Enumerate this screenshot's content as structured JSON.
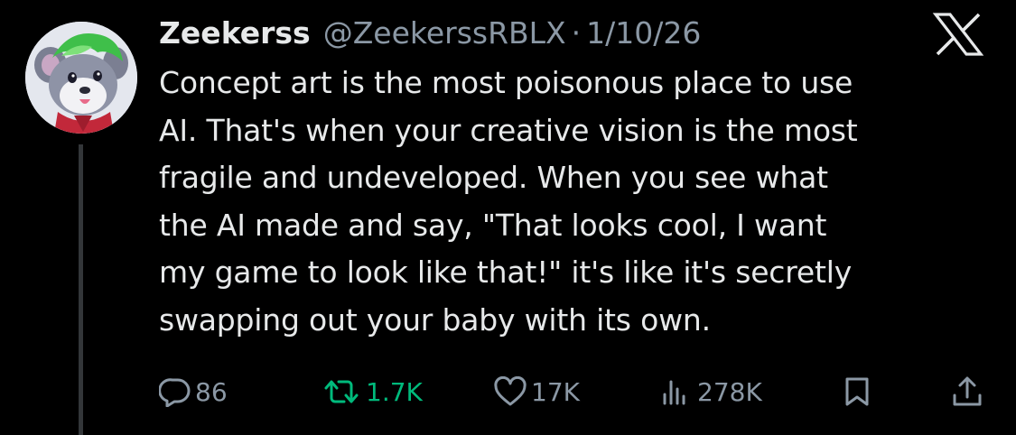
{
  "author": {
    "display_name": "Zeekerss",
    "handle": "@ZeekerssRBLX",
    "separator": "·",
    "date": "1/10/26"
  },
  "tweet": {
    "lines": [
      "Concept art is the most poisonous place to use",
      "AI. That's when your creative vision is the most",
      "fragile and undeveloped. When you see what",
      "the AI made and say, \"That looks cool, I want",
      "my game to look like that!\" it's like it's secretly",
      "swapping out your baby with its own."
    ]
  },
  "actions": {
    "replies": "86",
    "reposts": "1.7K",
    "likes": "17K",
    "views": "278K"
  },
  "icons": {
    "brand": "x-logo-icon",
    "reply": "reply-icon",
    "repost": "repost-icon",
    "like": "heart-icon",
    "views": "views-icon",
    "bookmark": "bookmark-icon",
    "share": "share-icon"
  },
  "colors": {
    "background": "#000000",
    "text": "#e7e9ea",
    "muted": "#8b98a5",
    "repost_active": "#00ba7c",
    "thread_line": "#333639"
  }
}
